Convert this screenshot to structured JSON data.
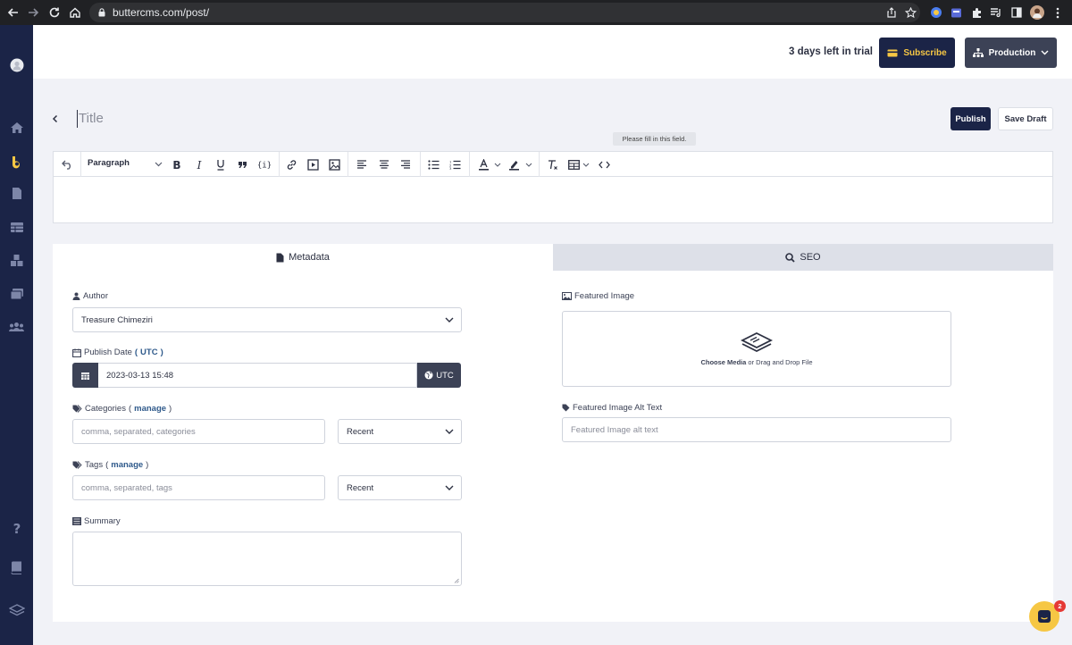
{
  "browser": {
    "url": "buttercms.com/post/",
    "icons": [
      "back-icon",
      "forward-icon",
      "reload-icon",
      "home-icon",
      "lock-icon",
      "share-icon",
      "star-icon",
      "extension-icon",
      "puzzle-icon",
      "media-control-icon",
      "sidebar-icon",
      "profile-avatar",
      "kebab-menu-icon"
    ]
  },
  "sidebar": {
    "items": [
      "avatar",
      "home-icon",
      "butter-logo-icon",
      "pages-icon",
      "collections-icon",
      "components-icon",
      "media-icon",
      "users-icon",
      "help-icon",
      "book-icon",
      "layers-icon"
    ]
  },
  "header": {
    "trial_text": "3 days left in trial",
    "subscribe_label": "Subscribe",
    "production_label": "Production"
  },
  "post": {
    "title_placeholder": "Title",
    "publish_label": "Publish",
    "save_draft_label": "Save Draft",
    "tooltip": "Please fill in this field."
  },
  "editor": {
    "block_format": "Paragraph",
    "tools": [
      "undo",
      "bold",
      "italic",
      "underline",
      "quote",
      "code",
      "link",
      "video",
      "image",
      "align-left",
      "align-center",
      "align-right",
      "bullet-list",
      "numbered-list",
      "text-color",
      "highlight",
      "clear-format",
      "table",
      "source-code"
    ]
  },
  "tabs": {
    "metadata": "Metadata",
    "seo": "SEO",
    "active": "Metadata"
  },
  "metadata": {
    "author_label": "Author",
    "author_value": "Treasure Chimeziri",
    "publish_date_label": "Publish Date",
    "publish_date_paren_open": "(",
    "publish_date_utc": "UTC",
    "publish_date_paren_close": ")",
    "publish_date_value": "2023-03-13 15:48",
    "utc_button": "UTC",
    "categories_label": "Categories",
    "categories_manage": "manage",
    "categories_placeholder": "comma, separated, categories",
    "categories_sort": "Recent",
    "tags_label": "Tags",
    "tags_manage": "manage",
    "tags_placeholder": "comma, separated, tags",
    "tags_sort": "Recent",
    "summary_label": "Summary",
    "featured_image_label": "Featured Image",
    "choose_media": "Choose Media",
    "drag_drop": "or Drag and Drop File",
    "alt_text_label": "Featured Image Alt Text",
    "alt_text_placeholder": "Featured Image alt text"
  },
  "chat": {
    "badge_count": "2"
  },
  "colors": {
    "navy": "#1b2447",
    "slate": "#3c4256",
    "accent_yellow": "#f6c744",
    "link_blue": "#2f5a8b",
    "badge_red": "#e53935"
  }
}
